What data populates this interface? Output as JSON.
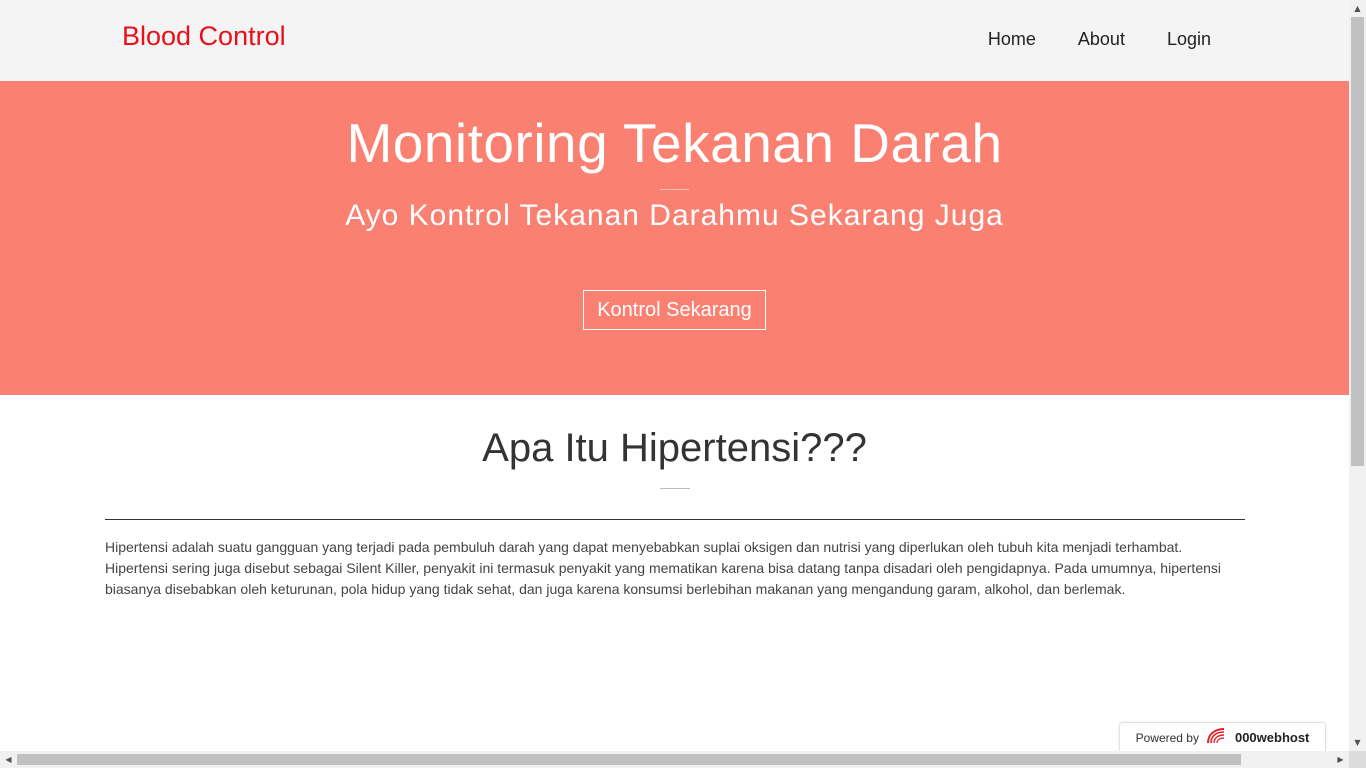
{
  "navbar": {
    "brand": "Blood Control",
    "links": [
      "Home",
      "About",
      "Login"
    ]
  },
  "hero": {
    "title": "Monitoring Tekanan Darah",
    "subtitle": "Ayo Kontrol Tekanan Darahmu Sekarang Juga",
    "cta_label": "Kontrol Sekarang"
  },
  "section": {
    "heading": "Apa Itu Hipertensi???",
    "paragraph": "Hipertensi adalah suatu gangguan yang terjadi pada pembuluh darah yang dapat menyebabkan suplai oksigen dan nutrisi yang diperlukan oleh tubuh kita menjadi terhambat. Hipertensi sering juga disebut sebagai Silent Killer, penyakit ini termasuk penyakit yang mematikan karena bisa datang tanpa disadari oleh pengidapnya. Pada umumnya, hipertensi biasanya disebabkan oleh keturunan, pola hidup yang tidak sehat, dan juga karena konsumsi berlebihan makanan yang mengandung garam, alkohol, dan berlemak."
  },
  "badge": {
    "powered_label": "Powered by",
    "host_name": "000webhost",
    "icon": "000webhost-logo-icon"
  },
  "colors": {
    "brand": "#e8101a",
    "hero_bg": "#fa8072",
    "navbar_bg": "#f4f4f4"
  },
  "icons": {
    "scroll_up": "arrow-up-icon",
    "scroll_down": "arrow-down-icon",
    "scroll_left": "arrow-left-icon",
    "scroll_right": "arrow-right-icon"
  }
}
